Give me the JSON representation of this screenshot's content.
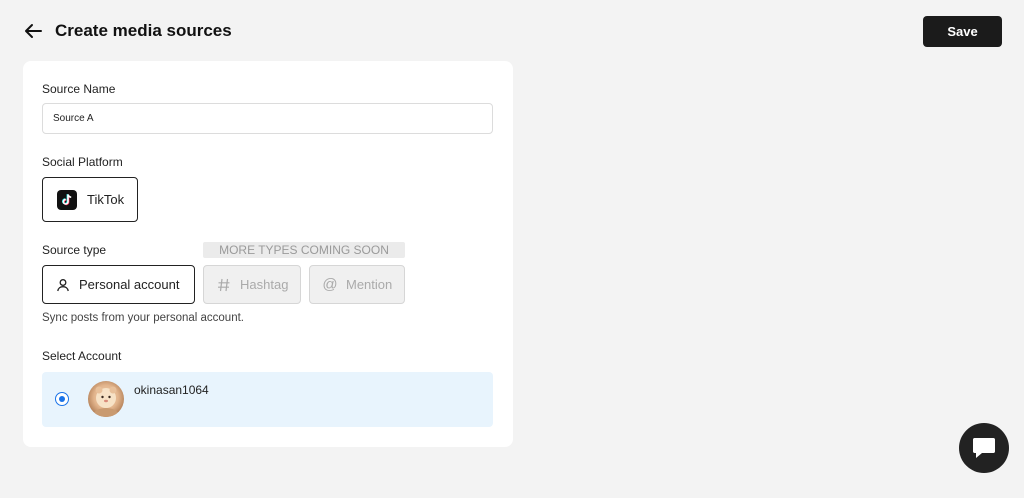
{
  "header": {
    "back_icon": "arrow-left-icon",
    "title": "Create media sources",
    "save_label": "Save"
  },
  "form": {
    "source_name": {
      "label": "Source Name",
      "value": "Source A"
    },
    "social_platform": {
      "label": "Social Platform",
      "selected": "TikTok",
      "icon": "tiktok-logo-icon"
    },
    "source_type": {
      "label": "Source type",
      "coming_soon": "MORE TYPES COMING SOON",
      "options": [
        {
          "label": "Personal account",
          "icon": "user-icon",
          "selected": true,
          "disabled": false
        },
        {
          "label": "Hashtag",
          "icon": "hashtag-icon",
          "selected": false,
          "disabled": true
        },
        {
          "label": "Mention",
          "icon": "at-icon",
          "selected": false,
          "disabled": true
        }
      ],
      "helper": "Sync posts from your personal account."
    },
    "select_account": {
      "label": "Select Account",
      "accounts": [
        {
          "name": "okinasan1064",
          "selected": true
        }
      ]
    }
  },
  "chat": {
    "icon": "chat-bubble-icon"
  },
  "colors": {
    "background": "#f3f3f3",
    "primary_button": "#1b1b1b",
    "selected_row": "#e8f4fd",
    "radio_accent": "#1a73e8"
  }
}
